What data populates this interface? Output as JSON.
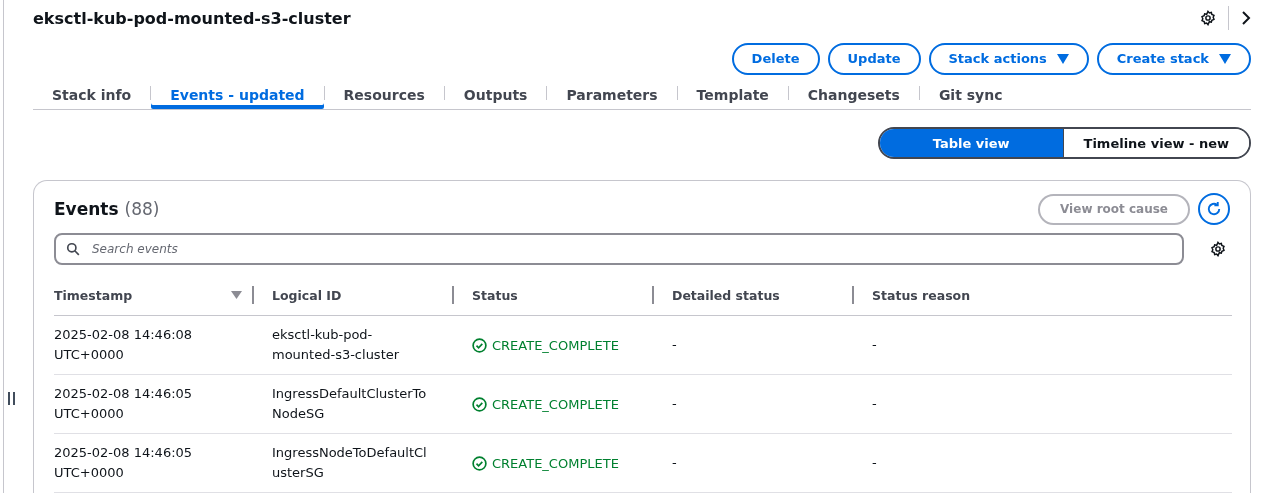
{
  "header": {
    "title": "eksctl-kub-pod-mounted-s3-cluster"
  },
  "actions": [
    {
      "label": "Delete",
      "kind": "plain"
    },
    {
      "label": "Update",
      "kind": "plain"
    },
    {
      "label": "Stack actions",
      "kind": "dropdown"
    },
    {
      "label": "Create stack",
      "kind": "dropdown"
    }
  ],
  "tabs": [
    {
      "label": "Stack info",
      "selected": false
    },
    {
      "label": "Events - updated",
      "selected": true
    },
    {
      "label": "Resources",
      "selected": false
    },
    {
      "label": "Outputs",
      "selected": false
    },
    {
      "label": "Parameters",
      "selected": false
    },
    {
      "label": "Template",
      "selected": false
    },
    {
      "label": "Changesets",
      "selected": false
    },
    {
      "label": "Git sync",
      "selected": false
    }
  ],
  "view_toggle": [
    {
      "label": "Table view",
      "selected": true
    },
    {
      "label": "Timeline view - new",
      "selected": false
    }
  ],
  "events": {
    "title": "Events",
    "count": "(88)",
    "root_cause_button": {
      "label": "View root cause",
      "disabled": true
    },
    "search": {
      "placeholder": "Search events"
    },
    "columns": [
      "Timestamp",
      "Logical ID",
      "Status",
      "Detailed status",
      "Status reason"
    ],
    "rows": [
      {
        "timestamp": "2025-02-08 14:46:08 UTC+0000",
        "logical_id": "eksctl-kub-pod-mounted-s3-cluster",
        "status": "CREATE_COMPLETE",
        "detailed_status": "-",
        "status_reason": "-"
      },
      {
        "timestamp": "2025-02-08 14:46:05 UTC+0000",
        "logical_id": "IngressDefaultClusterToNodeSG",
        "status": "CREATE_COMPLETE",
        "detailed_status": "-",
        "status_reason": "-"
      },
      {
        "timestamp": "2025-02-08 14:46:05 UTC+0000",
        "logical_id": "IngressNodeToDefaultClusterSG",
        "status": "CREATE_COMPLETE",
        "detailed_status": "-",
        "status_reason": "-"
      }
    ]
  }
}
